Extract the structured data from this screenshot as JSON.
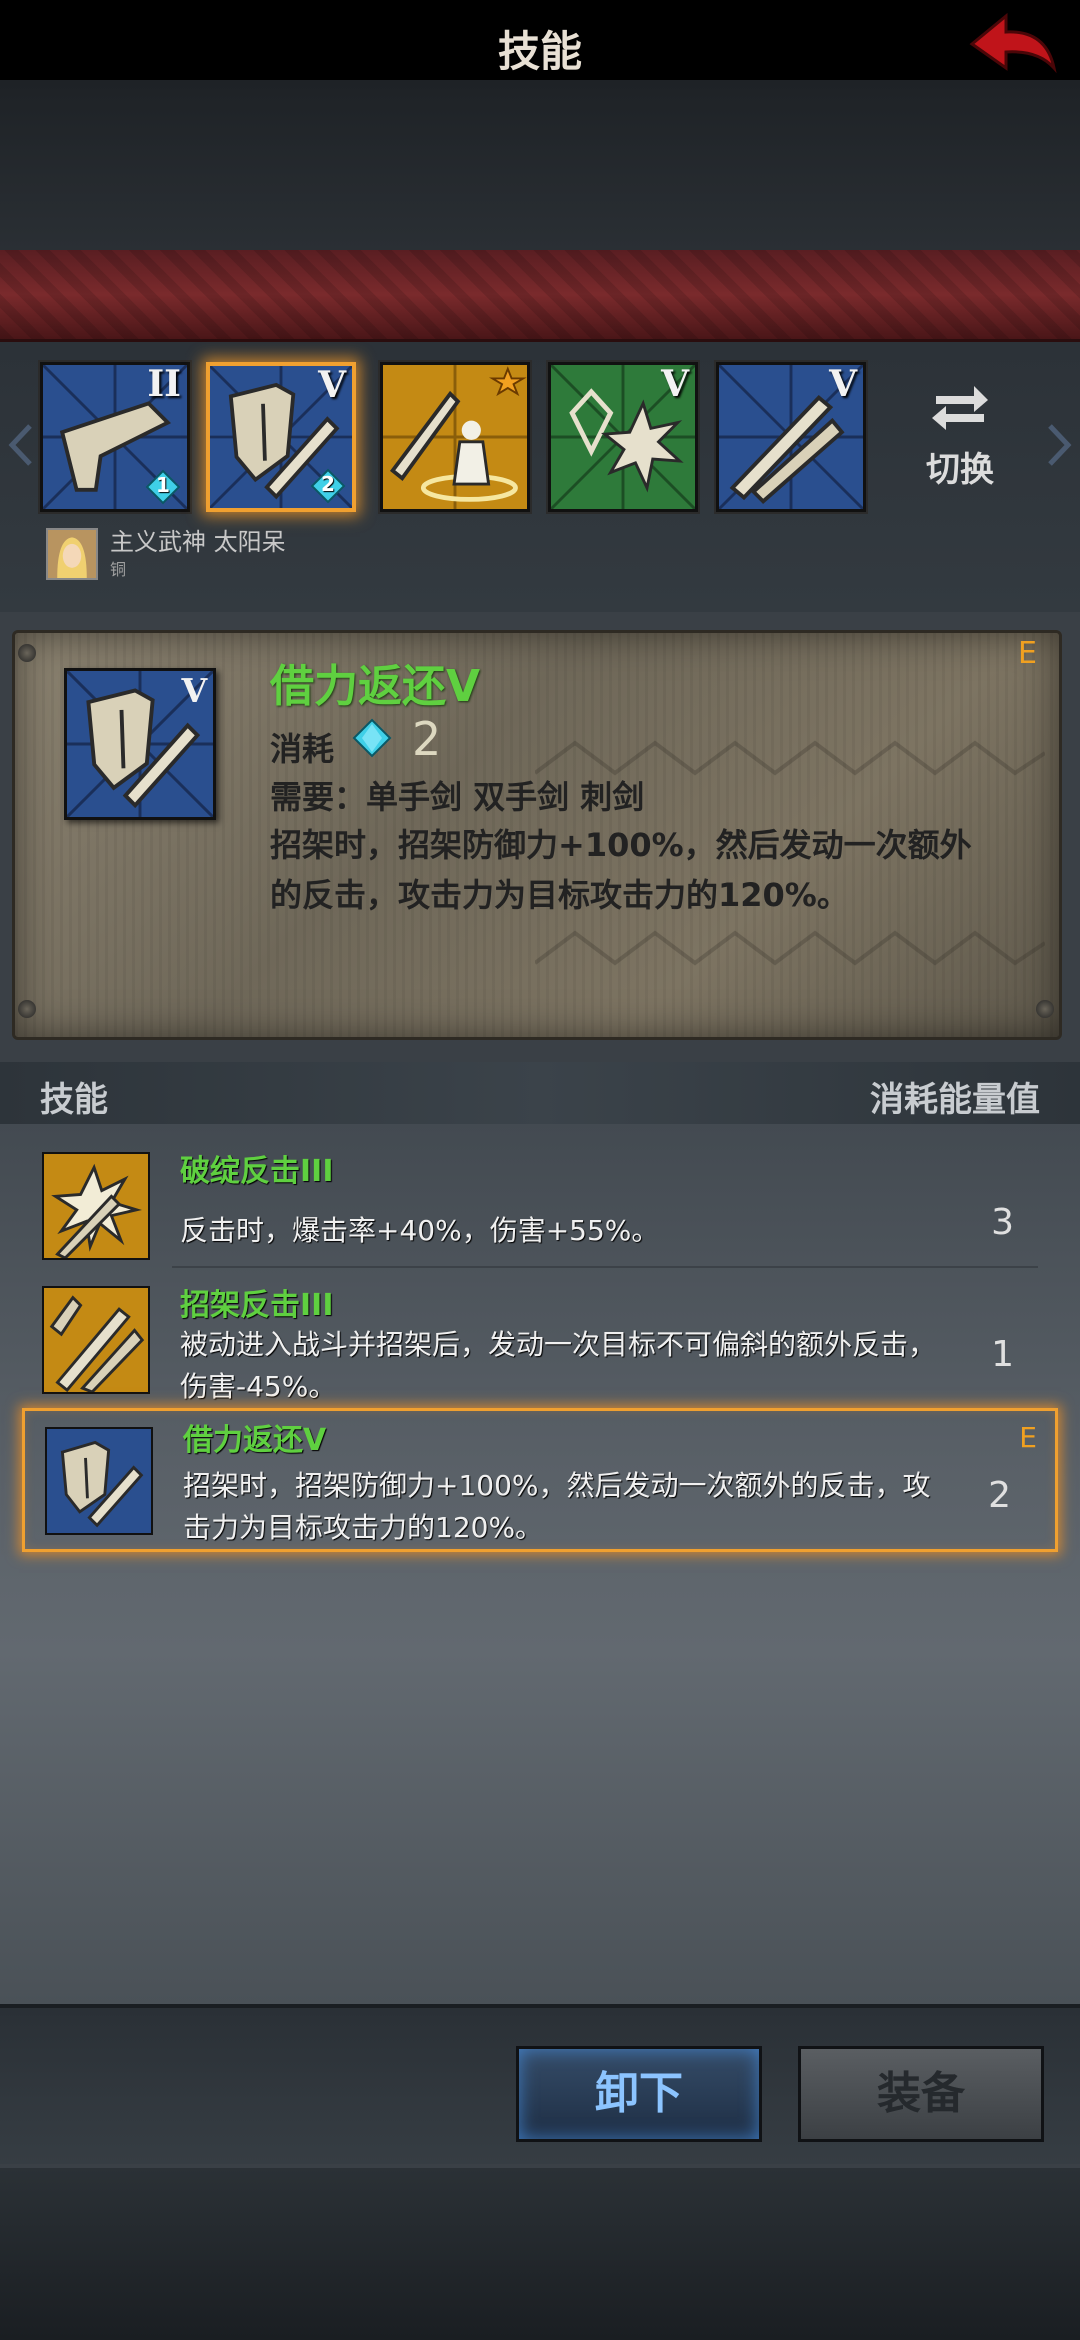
{
  "header": {
    "title": "技能",
    "back_icon": "back-arrow-icon"
  },
  "skill_slots": [
    {
      "name": "slot-1",
      "rank": "II",
      "gem": "1",
      "theme": "blue",
      "icon": "blade-skill-icon"
    },
    {
      "name": "slot-2",
      "rank": "V",
      "gem": "2",
      "theme": "blue",
      "icon": "shield-sword-icon",
      "selected": true
    },
    {
      "name": "slot-3",
      "rank": "",
      "gem": "",
      "theme": "gold",
      "icon": "warrior-summon-icon"
    },
    {
      "name": "slot-4",
      "rank": "V",
      "gem": "",
      "theme": "green",
      "icon": "crystal-burst-icon"
    },
    {
      "name": "slot-5",
      "rank": "V",
      "gem": "",
      "theme": "blue",
      "icon": "crossed-swords-icon"
    }
  ],
  "switch": {
    "label": "切换"
  },
  "owner": {
    "name": "主义武神 太阳呆",
    "sub": "铜"
  },
  "detail": {
    "name": "借力返还V",
    "rank": "E",
    "cost_label": "消耗",
    "cost_value": "2",
    "requirement": "需要：单手剑  双手剑  刺剑",
    "description": "招架时，招架防御力+100%，然后发动一次额外的反击，攻击力为目标攻击力的120%。"
  },
  "list_header": {
    "left": "技能",
    "right": "消耗能量值"
  },
  "skill_list": [
    {
      "name": "破绽反击III",
      "desc": "反击时，爆击率+40%，伤害+55%。",
      "cost": "3",
      "rank": "",
      "theme": "gold",
      "icon": "burst-strike-icon"
    },
    {
      "name": "招架反击III",
      "desc": "被动进入战斗并招架后，发动一次目标不可偏斜的额外反击，伤害-45%。",
      "cost": "1",
      "rank": "",
      "theme": "gold",
      "icon": "parry-swords-icon"
    },
    {
      "name": "借力返还V",
      "desc": "招架时，招架防御力+100%，然后发动一次额外的反击，攻击力为目标攻击力的120%。",
      "cost": "2",
      "rank": "E",
      "theme": "blue",
      "icon": "shield-sword-icon",
      "selected": true
    }
  ],
  "buttons": {
    "unequip": "卸下",
    "equip": "装备"
  },
  "colors": {
    "accent_orange": "#f0a030",
    "skill_green": "#5fd040",
    "title_red": "#7a2a2c"
  }
}
